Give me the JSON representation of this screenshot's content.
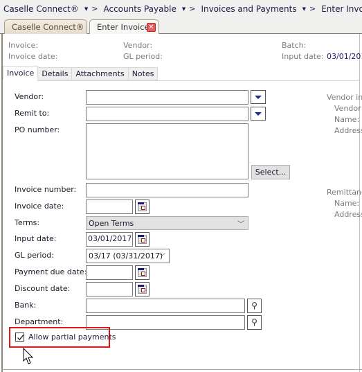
{
  "breadcrumb": {
    "items": [
      {
        "label": "Caselle Connect®"
      },
      {
        "label": "Accounts Payable"
      },
      {
        "label": "Invoices and Payments"
      },
      {
        "label": "Enter Invoices"
      }
    ],
    "separator": ">"
  },
  "doc_tabs": [
    {
      "label": "Caselle Connect®",
      "active": false
    },
    {
      "label": "Enter Invoices",
      "active": true,
      "close": "✕"
    }
  ],
  "summary": {
    "invoice_label": "Invoice:",
    "invoice_date_label": "Invoice date:",
    "vendor_label": "Vendor:",
    "gl_period_label": "GL period:",
    "batch_label": "Batch:",
    "input_date_label": "Input date:",
    "input_date_value": "03/01/201"
  },
  "subtabs": [
    {
      "label": "Invoice",
      "active": true
    },
    {
      "label": "Details"
    },
    {
      "label": "Attachments"
    },
    {
      "label": "Notes"
    }
  ],
  "form": {
    "vendor": {
      "label": "Vendor:",
      "value": ""
    },
    "remit_to": {
      "label": "Remit to:",
      "value": ""
    },
    "po_number": {
      "label": "PO number:",
      "value": ""
    },
    "select_button": "Select...",
    "invoice_number": {
      "label": "Invoice number:",
      "value": ""
    },
    "invoice_date": {
      "label": "Invoice date:",
      "value": ""
    },
    "terms": {
      "label": "Terms:",
      "value": "Open Terms"
    },
    "input_date": {
      "label": "Input date:",
      "value": "03/01/2017"
    },
    "gl_period": {
      "label": "GL period:",
      "value": "03/17 (03/31/2017)"
    },
    "payment_due_date": {
      "label": "Payment due date:",
      "value": ""
    },
    "discount_date": {
      "label": "Discount date:",
      "value": ""
    },
    "bank": {
      "label": "Bank:",
      "value": ""
    },
    "department": {
      "label": "Department:",
      "value": ""
    },
    "allow_partial_payments": {
      "label": "Allow partial payments",
      "checked": true
    }
  },
  "vendor_info": {
    "heading": "Vendor inf",
    "vendor_label": "Vendor",
    "name_label": "Name:",
    "address_label": "Address"
  },
  "remittance": {
    "heading": "Remittanc",
    "name_label": "Name:",
    "address_label": "Address"
  },
  "colors": {
    "highlight": "#e01818",
    "dropdown_arrow": "#1a2a8a"
  }
}
